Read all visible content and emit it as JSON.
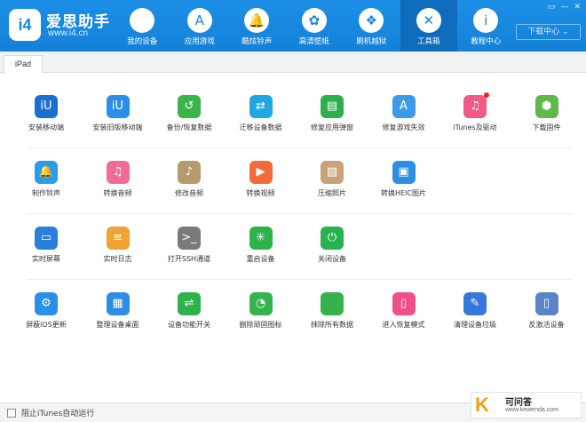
{
  "brand": {
    "name": "爱思助手",
    "url": "www.i4.cn",
    "logo_text": "i4"
  },
  "nav": [
    {
      "label": "我的设备",
      "icon": "apple-icon",
      "glyph": ""
    },
    {
      "label": "应用游戏",
      "icon": "app-store-icon",
      "glyph": "A"
    },
    {
      "label": "酷炫铃声",
      "icon": "bell-icon",
      "glyph": "🔔"
    },
    {
      "label": "高清壁纸",
      "icon": "flower-icon",
      "glyph": "✿"
    },
    {
      "label": "刷机越狱",
      "icon": "box-icon",
      "glyph": "❖"
    },
    {
      "label": "工具箱",
      "icon": "tools-icon",
      "glyph": "✕",
      "active": true
    },
    {
      "label": "教程中心",
      "icon": "info-icon",
      "glyph": "i"
    }
  ],
  "header": {
    "download_center": "下载中心 ⌄",
    "window_controls": [
      "▭",
      "—",
      "✕"
    ]
  },
  "tabs": [
    {
      "label": "iPad"
    }
  ],
  "rows": [
    [
      {
        "label": "安装移动端",
        "icon": "i4-install-icon",
        "glyph": "iU",
        "color": "#1a6fd1"
      },
      {
        "label": "安装旧版移动端",
        "icon": "i4-old-install-icon",
        "glyph": "iU",
        "color": "#2b8ee8"
      },
      {
        "label": "备份/恢复数据",
        "icon": "backup-restore-icon",
        "glyph": "↺",
        "color": "#3bb54a"
      },
      {
        "label": "迁移设备数据",
        "icon": "migrate-data-icon",
        "glyph": "⇄",
        "color": "#1fa7e0"
      },
      {
        "label": "修复应用弹窗",
        "icon": "fix-app-popup-icon",
        "glyph": "▤",
        "color": "#2fae4f"
      },
      {
        "label": "修复游戏失效",
        "icon": "fix-game-icon",
        "glyph": "A",
        "color": "#3d9ae6"
      },
      {
        "label": "iTunes及驱动",
        "icon": "itunes-icon",
        "glyph": "♫",
        "color": "#f05a86",
        "badge": true
      },
      {
        "label": "下载固件",
        "icon": "firmware-icon",
        "glyph": "⬢",
        "color": "#5fb84a"
      }
    ],
    [
      {
        "label": "制作铃声",
        "icon": "make-ringtone-icon",
        "glyph": "🔔",
        "color": "#2a9ce8"
      },
      {
        "label": "转换音频",
        "icon": "convert-audio-icon",
        "glyph": "♫",
        "color": "#f06c98"
      },
      {
        "label": "修改音频",
        "icon": "edit-audio-icon",
        "glyph": "♪",
        "color": "#b59a6d"
      },
      {
        "label": "转换视频",
        "icon": "convert-video-icon",
        "glyph": "▶",
        "color": "#f36b3b"
      },
      {
        "label": "压缩照片",
        "icon": "compress-photo-icon",
        "glyph": "▨",
        "color": "#c9a27a"
      },
      {
        "label": "转换HEIC图片",
        "icon": "convert-heic-icon",
        "glyph": "▣",
        "color": "#2c8fe2"
      }
    ],
    [
      {
        "label": "实时屏幕",
        "icon": "realtime-screen-icon",
        "glyph": "▭",
        "color": "#2a7fd8"
      },
      {
        "label": "实时日志",
        "icon": "realtime-log-icon",
        "glyph": "≡",
        "color": "#f0a233"
      },
      {
        "label": "打开SSH通道",
        "icon": "ssh-icon",
        "glyph": ">_",
        "color": "#7a7a7a"
      },
      {
        "label": "重启设备",
        "icon": "restart-icon",
        "glyph": "✳",
        "color": "#2eb24a"
      },
      {
        "label": "关闭设备",
        "icon": "shutdown-icon",
        "glyph": "⏻",
        "color": "#27b34d"
      }
    ],
    [
      {
        "label": "屏蔽iOS更新",
        "icon": "block-update-icon",
        "glyph": "⚙",
        "color": "#2b8ee8"
      },
      {
        "label": "整理设备桌面",
        "icon": "organize-desktop-icon",
        "glyph": "▦",
        "color": "#2a8de6"
      },
      {
        "label": "设备功能开关",
        "icon": "feature-toggle-icon",
        "glyph": "⇌",
        "color": "#2db24c"
      },
      {
        "label": "删除顽固图标",
        "icon": "delete-icon-icon",
        "glyph": "◔",
        "color": "#34b44c"
      },
      {
        "label": "抹除所有数据",
        "icon": "erase-data-icon",
        "glyph": "",
        "color": "#36b24b"
      },
      {
        "label": "进入恢复模式",
        "icon": "recovery-mode-icon",
        "glyph": "▯",
        "color": "#f0508a"
      },
      {
        "label": "清理设备垃圾",
        "icon": "clean-junk-icon",
        "glyph": "✎",
        "color": "#3578dc"
      },
      {
        "label": "反激活设备",
        "icon": "deactivate-icon",
        "glyph": "▯",
        "color": "#5a84c8"
      }
    ]
  ],
  "status": {
    "checkbox_label": "阻止iTunes自动运行"
  },
  "watermark": {
    "mark": "K",
    "title": "可问答",
    "url": "www.kewenda.com"
  }
}
